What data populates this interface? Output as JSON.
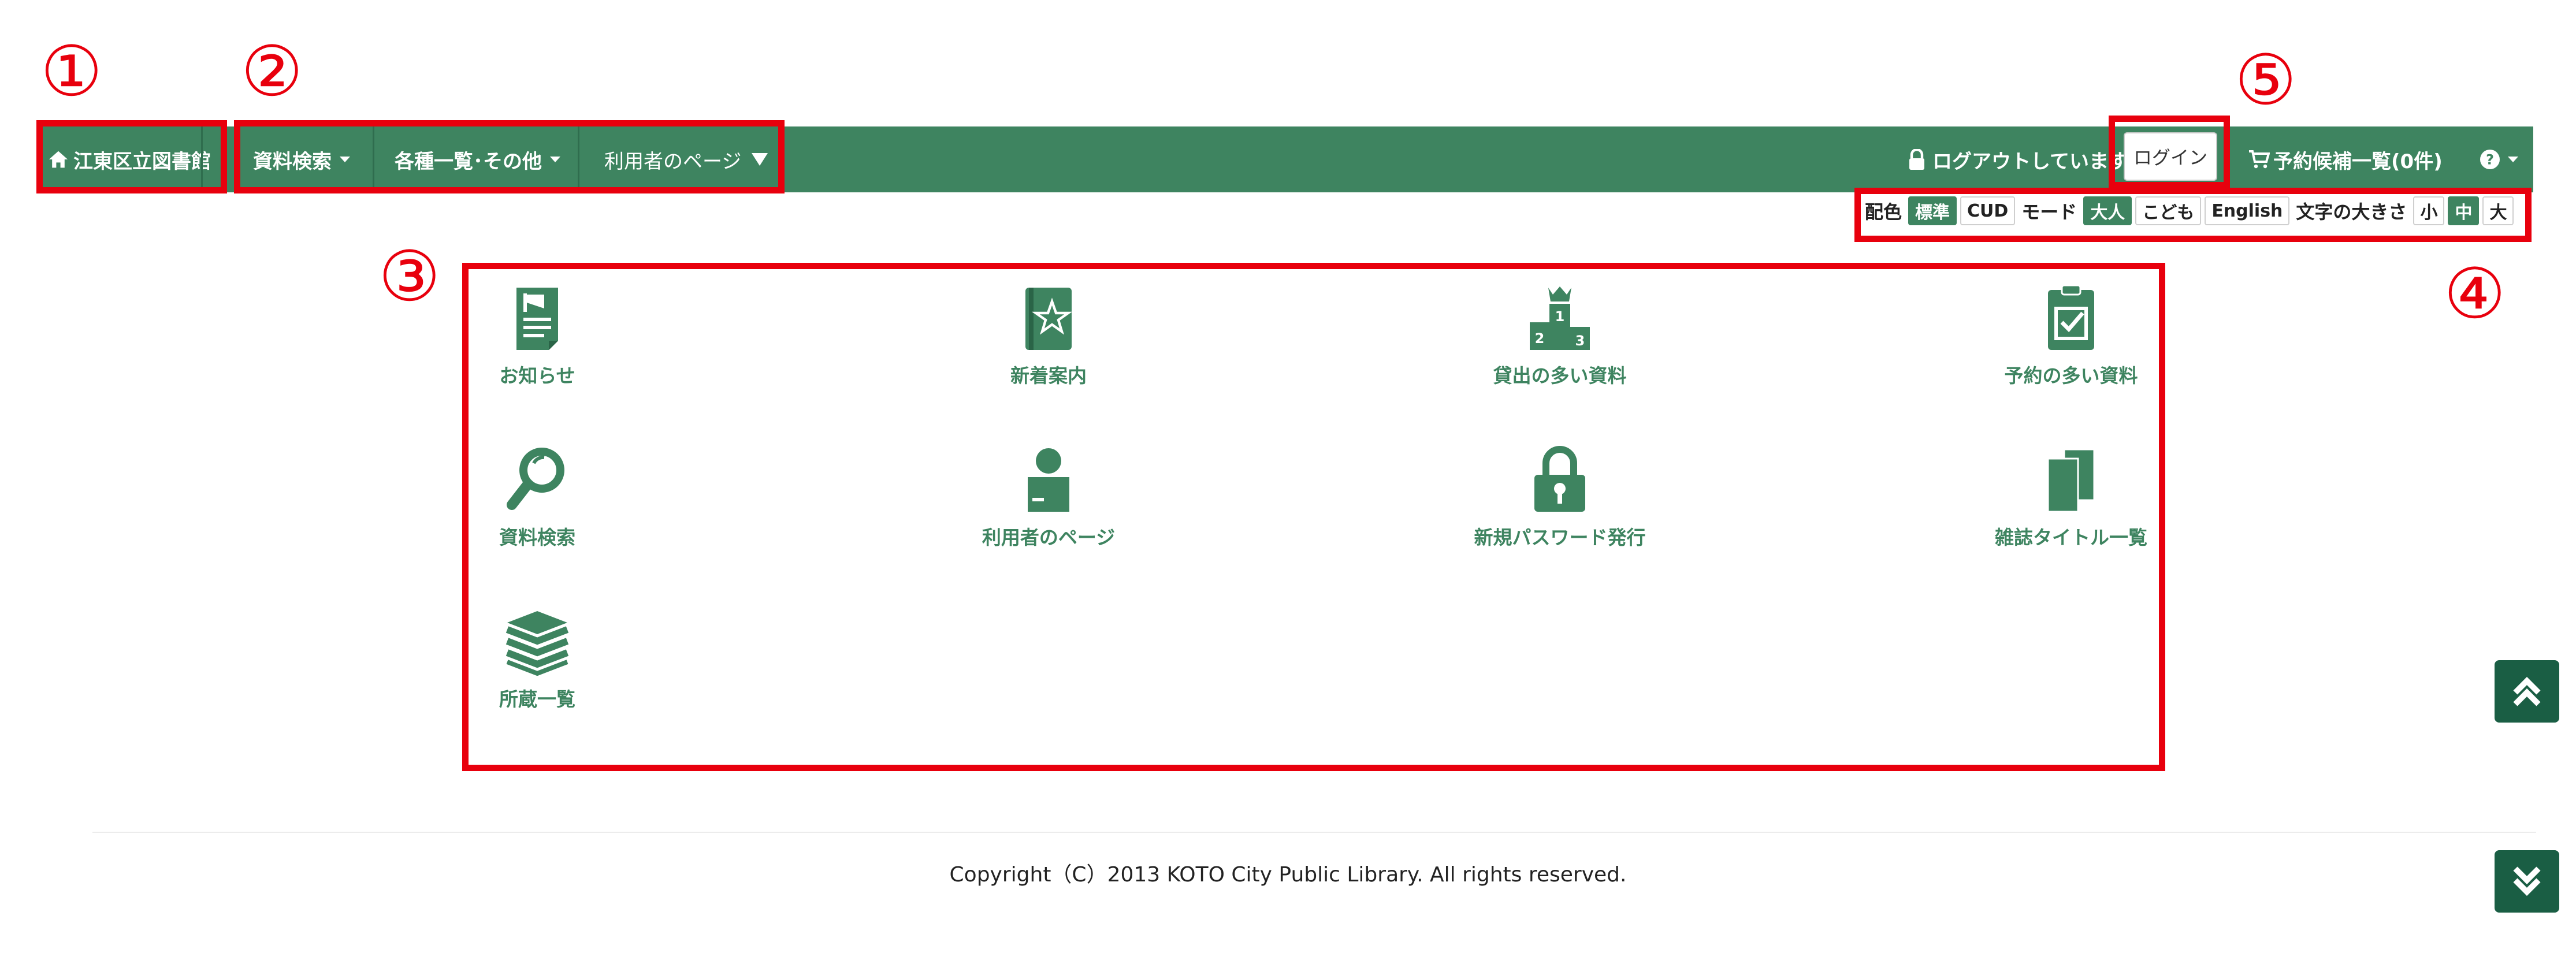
{
  "navbar": {
    "home_label": "江東区立図書館",
    "menu": [
      {
        "label": "資料検索"
      },
      {
        "label": "各種一覧･その他"
      },
      {
        "label": "利用者のページ"
      }
    ],
    "logout_status": "ログアウトしています",
    "login_label": "ログイン",
    "cart_label": "予約候補一覧(0件)"
  },
  "settings": {
    "color_label": "配色",
    "color_standard": "標準",
    "color_cud": "CUD",
    "mode_label": "モード",
    "mode_adult": "大人",
    "mode_child": "こども",
    "english": "English",
    "font_size_label": "文字の大きさ",
    "size_small": "小",
    "size_medium": "中",
    "size_large": "大"
  },
  "tiles": [
    {
      "label": "お知らせ",
      "icon": "notice-icon"
    },
    {
      "label": "新着案内",
      "icon": "new-arrivals-icon"
    },
    {
      "label": "貸出の多い資料",
      "icon": "ranking-podium-icon"
    },
    {
      "label": "予約の多い資料",
      "icon": "reserved-clipboard-icon"
    },
    {
      "label": "資料検索",
      "icon": "magnifier-icon"
    },
    {
      "label": "利用者のページ",
      "icon": "user-icon"
    },
    {
      "label": "新規パスワード発行",
      "icon": "padlock-icon"
    },
    {
      "label": "雑誌タイトル一覧",
      "icon": "magazine-icon"
    },
    {
      "label": "所蔵一覧",
      "icon": "books-stack-icon"
    }
  ],
  "annotations": [
    "①",
    "②",
    "③",
    "④",
    "⑤"
  ],
  "footer": {
    "copyright": "Copyright（C）2013 KOTO City Public Library. All rights reserved."
  },
  "colors": {
    "brand_green": "#3e8460",
    "annotation_red": "#e8000d",
    "scroll_button": "#1a5e44"
  }
}
